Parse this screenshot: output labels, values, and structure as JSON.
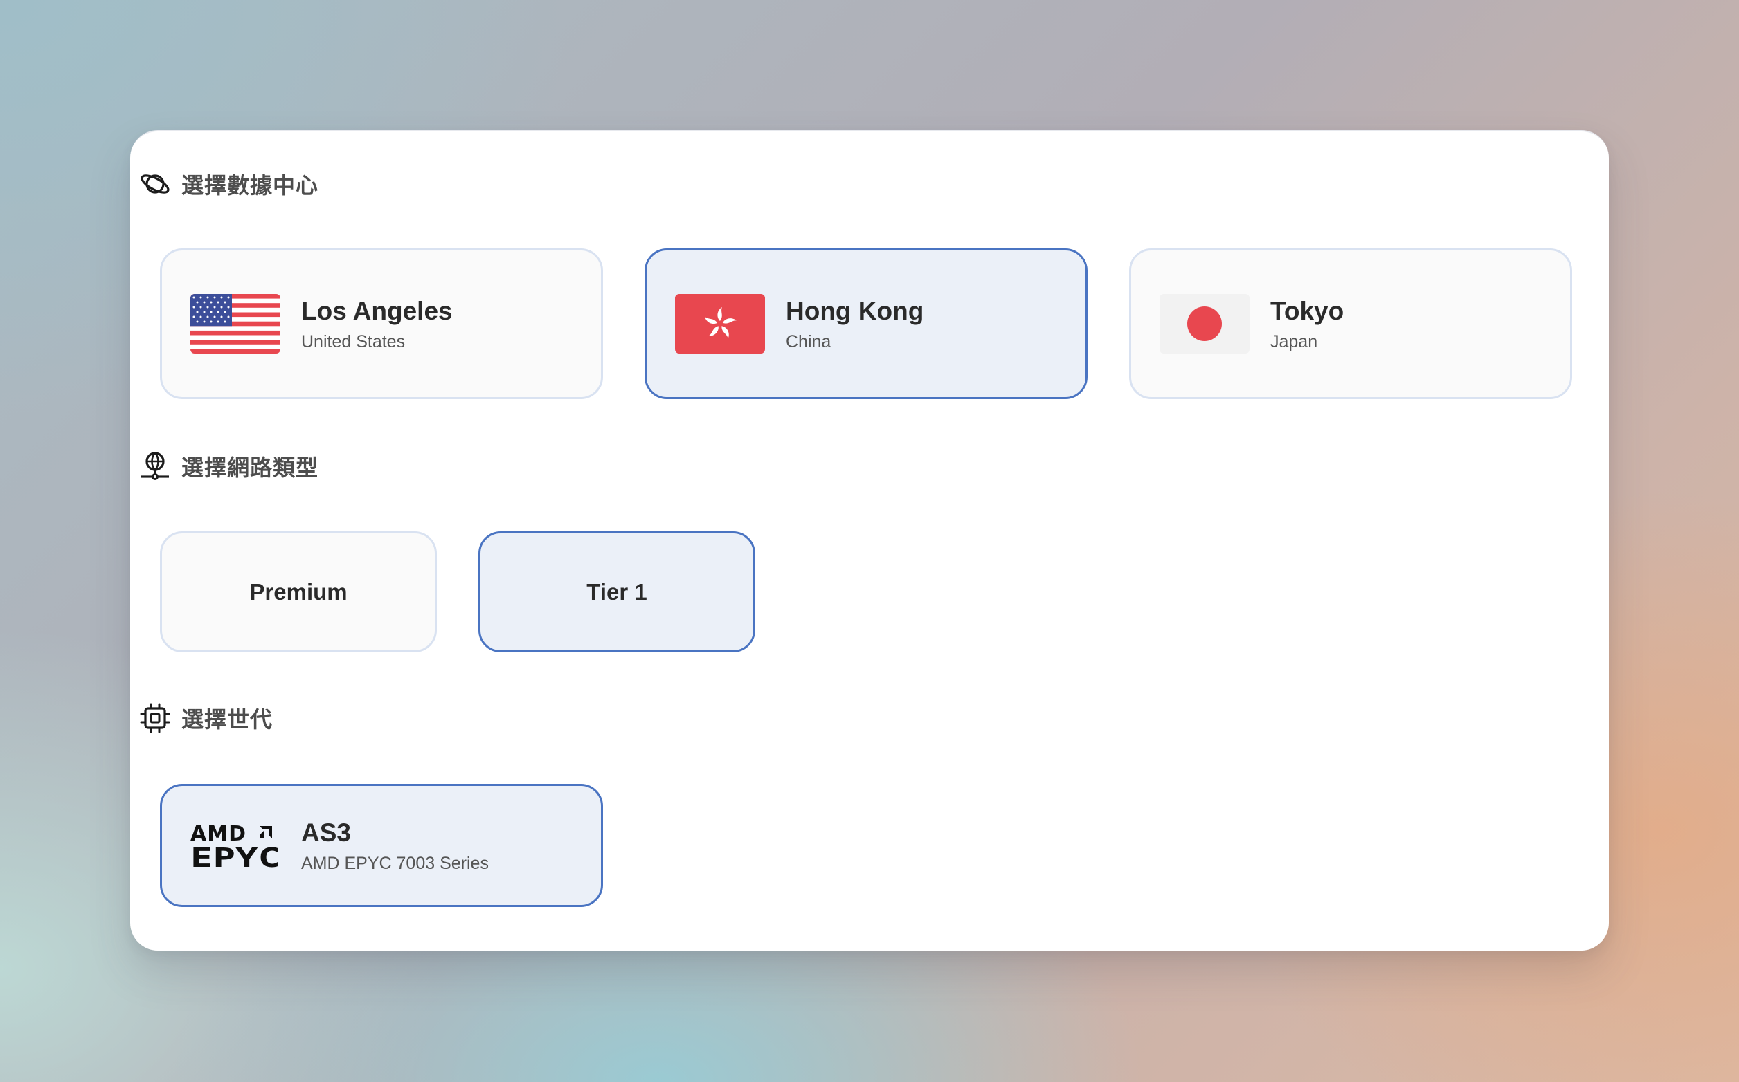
{
  "sections": {
    "datacenter": {
      "title": "選擇數據中心",
      "icon": "planet-icon",
      "items": [
        {
          "city": "Los Angeles",
          "country": "United States",
          "flag": "us-flag-icon",
          "selected": false
        },
        {
          "city": "Hong Kong",
          "country": "China",
          "flag": "hk-flag-icon",
          "selected": true
        },
        {
          "city": "Tokyo",
          "country": "Japan",
          "flag": "jp-flag-icon",
          "selected": false
        }
      ]
    },
    "network": {
      "title": "選擇網路類型",
      "icon": "network-globe-icon",
      "items": [
        {
          "label": "Premium",
          "selected": false
        },
        {
          "label": "Tier 1",
          "selected": true
        }
      ]
    },
    "generation": {
      "title": "選擇世代",
      "icon": "cpu-chip-icon",
      "items": [
        {
          "name": "AS3",
          "description": "AMD EPYC 7003 Series",
          "logo": "amd-epyc-logo",
          "logo_text": [
            "AMD",
            "EPYC"
          ],
          "selected": true
        }
      ]
    }
  },
  "colors": {
    "selected_border": "#4a74c2",
    "selected_bg": "#ebf0f8",
    "card_border": "#d9e2f1",
    "card_bg": "#fafafa",
    "flag_red": "#e8474f"
  }
}
